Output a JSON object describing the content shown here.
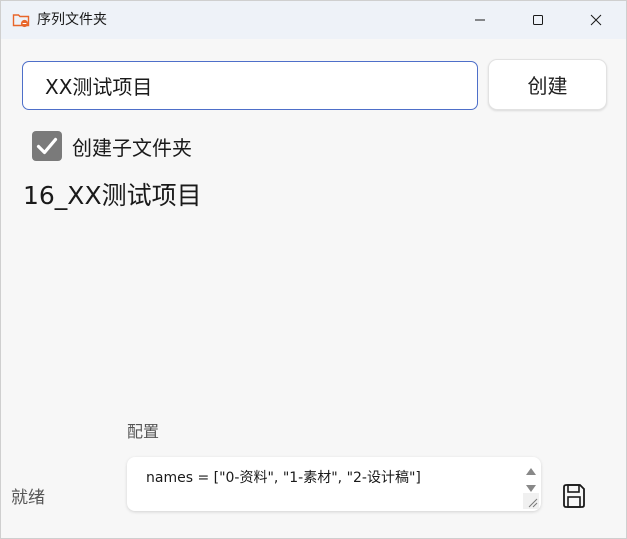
{
  "window": {
    "title": "序列文件夹"
  },
  "form": {
    "name_value": "XX测试项目",
    "create_label": "创建",
    "subfolder_label": "创建子文件夹",
    "subfolder_checked": true
  },
  "result": {
    "folder_name": "16_XX测试项目"
  },
  "config": {
    "label": "配置",
    "text": "names = [\"0-资料\", \"1-素材\", \"2-设计稿\"]"
  },
  "status": {
    "text": "就绪"
  },
  "colors": {
    "accent_border": "#4e6fc9",
    "checkbox_fill": "#7a7a7a",
    "titlebar_bg": "#eef2f8",
    "app_icon": "#e8662b"
  },
  "icons": {
    "app": "folder-icon",
    "minimize": "minimize-icon",
    "maximize": "maximize-icon",
    "close": "close-icon",
    "checkbox": "checkmark-icon",
    "save": "save-icon"
  }
}
